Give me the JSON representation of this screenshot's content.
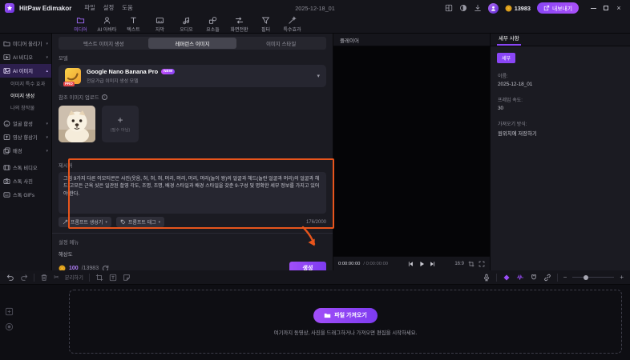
{
  "colors": {
    "accent": "#8a46f6",
    "annotation": "#e8551c"
  },
  "glyphs": {
    "chevron_down": "▾",
    "chevron_up": "▴",
    "plus": "+",
    "minus": "−",
    "close": "×",
    "scissors": "✂",
    "info": "i"
  },
  "titlebar": {
    "app_name": "HitPaw Edimakor",
    "menus": [
      "파일",
      "설정",
      "도움"
    ],
    "project_name": "2025-12-18_01",
    "coin_count": "13983",
    "export_label": "내보내기"
  },
  "ribbon": {
    "items": [
      {
        "label": "미디어"
      },
      {
        "label": "AI 아바타"
      },
      {
        "label": "텍스트"
      },
      {
        "label": "자막"
      },
      {
        "label": "오디오"
      },
      {
        "label": "요소들"
      },
      {
        "label": "화면전환"
      },
      {
        "label": "필터"
      },
      {
        "label": "특수효과"
      }
    ]
  },
  "sidebar": {
    "items": [
      {
        "label": "미디어 올리기"
      },
      {
        "label": "AI 비디오"
      },
      {
        "label": "AI 이미지"
      },
      {
        "label": "얼굴 합성"
      },
      {
        "label": "영상 향상기"
      },
      {
        "label": "배경"
      },
      {
        "label": "스톡 비디오"
      },
      {
        "label": "스톡 사진"
      },
      {
        "label": "스톡 GIFs"
      }
    ],
    "ai_image_children": [
      {
        "label": "이미지 특수 효과"
      },
      {
        "label": "이미지 생성"
      },
      {
        "label": "나의 창작물"
      }
    ]
  },
  "generator": {
    "tabs": [
      {
        "label": "텍스트 이미지 생성"
      },
      {
        "label": "레퍼런스 이미지"
      },
      {
        "label": "이미지 스타일"
      }
    ],
    "model_section_label": "모델",
    "model": {
      "name": "Google Nano Banana Pro",
      "badge": "NEW",
      "pro": "PRO",
      "desc": "전문가급 이미지 생성 모델"
    },
    "reference_label": "참조 이미지 업로드",
    "upload_hint": "(필수 아님)",
    "prompt_label": "제시어",
    "prompt_text": "그림 9가지 다른 이모티콘은 사진(웃음, 혀, 혀, 혀, 머리, 머리, 머리, 머리(놀이 왕)의 얼굴과 헤드(놀란 얼굴과 머리)의 얼굴과 헤드(고모든 근육 샷은 일관된 촬영 각도, 조명, 조명, 배경 스타일과 배경 스타일을 갖춘 9-구성 및 명확한 세부 정보를 가지고 있어야 한다.",
    "char_count": "176/2000",
    "prompt_generator_label": "프롬프트 생성기",
    "prompt_tag_label": "프롬프트 태그",
    "settings_label": "설정 메뉴",
    "resolution_label": "해상도",
    "credit_cost": "100",
    "credit_total": "/13983",
    "generate_label": "생성"
  },
  "player": {
    "title": "플레이어",
    "time_current": "0:00:00:00",
    "time_total": "/ 0:00:00:00",
    "ratio": "16:9"
  },
  "details": {
    "tab_label": "세부 사항",
    "badge": "세부",
    "fields": [
      {
        "label": "이름:",
        "value": "2025-12-18_01"
      },
      {
        "label": "프레임 속도:",
        "value": "30"
      },
      {
        "label": "가져오기 방식:",
        "value": "원위치에 저장하기"
      }
    ]
  },
  "timeline": {
    "split_label": "분리하기",
    "import_button_label": "파일 가져오기",
    "import_hint": "여기까지 동영상, 사진을 드래그하거나 가져오면 편집을 시작하세요."
  }
}
